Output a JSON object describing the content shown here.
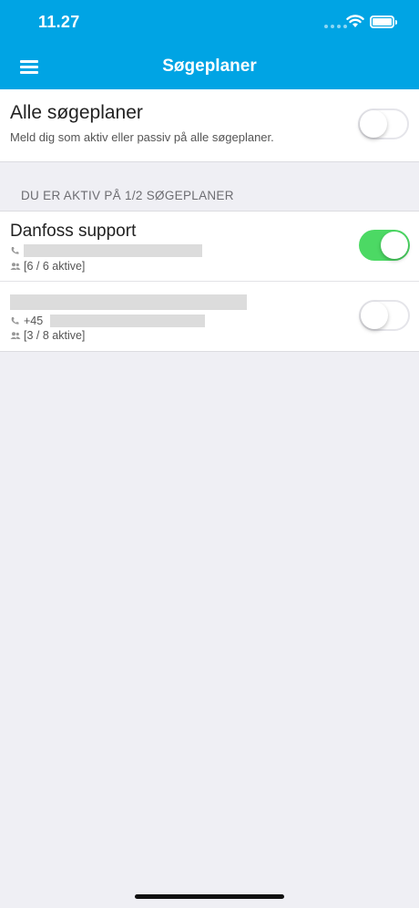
{
  "status_bar": {
    "time": "11.27"
  },
  "nav": {
    "title": "Søgeplaner"
  },
  "all_plans": {
    "title": "Alle søgeplaner",
    "description": "Meld dig som aktiv eller passiv på alle søgeplaner.",
    "toggle_on": false
  },
  "section_header": "DU ER AKTIV PÅ 1/2 SØGEPLANER",
  "plans": [
    {
      "name": "Danfoss support",
      "phone": "",
      "members": "[6 / 6 aktive]",
      "active": true
    },
    {
      "name": "",
      "phone": "+45",
      "members": "[3 / 8 aktive]",
      "active": false
    }
  ],
  "colors": {
    "accent": "#00a4e4",
    "toggle_on": "#4cd964",
    "background": "#efeff4"
  }
}
